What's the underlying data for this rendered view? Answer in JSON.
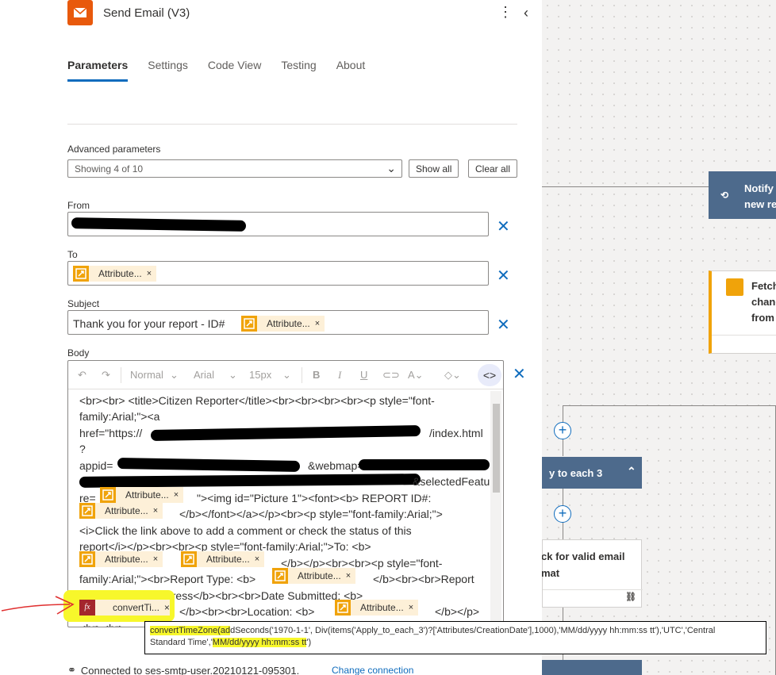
{
  "header": {
    "title": "Send Email (V3)",
    "icon": "mail-icon",
    "accent": "#e8590c"
  },
  "tabs": [
    {
      "label": "Parameters",
      "active": true
    },
    {
      "label": "Settings",
      "active": false
    },
    {
      "label": "Code View",
      "active": false
    },
    {
      "label": "Testing",
      "active": false
    },
    {
      "label": "About",
      "active": false
    }
  ],
  "advanced": {
    "label": "Advanced parameters",
    "value": "Showing 4 of 10",
    "show_all": "Show all",
    "clear_all": "Clear all"
  },
  "fields": {
    "from_label": "From",
    "to_label": "To",
    "to_token": "Attribute...",
    "subject_label": "Subject",
    "subject_text": "Thank you for your report - ID#",
    "subject_token": "Attribute...",
    "body_label": "Body"
  },
  "toolbar": {
    "style": "Normal",
    "font": "Arial",
    "size": "15px"
  },
  "body_lines": {
    "l1": "<br><br>  <title>Citizen Reporter</title><br><br><br><br><p style=\"font-",
    "l2": "family:Arial;\"><a",
    "l3": "href=\"https://",
    "l3b": "/index.html",
    "l4": "?",
    "l5": "appid=",
    "l5b": "&webmap=",
    "l6b": "&selectedFeatu",
    "l7a": "re=",
    "l7b": "\"><img id=\"Picture 1\"><font><b> REPORT ID#:",
    "l8": "</b></font></a></p><br><p style=\"font-family:Arial;\">",
    "l9": "<i>Click the link above to add a comment or check the status of this",
    "l10": "report</i></p><br><br><p style=\"font-family:Arial;\">To: <b>",
    "l11": "</b></p><br><br><p style=\"font-",
    "l12": "family:Arial;\"><br>Report Type: <b>",
    "l12b": "</b><br><br>Report",
    "l13": "Status: <b>In Progress</b><br><br>Date Submitted: <b>",
    "l14": "</b><br><br>Location: <b>",
    "l14b": "</b></p>",
    "l15": "<br><br>"
  },
  "tokens": {
    "attr": "Attribute...",
    "fx": "convertTi..."
  },
  "tooltip": {
    "highlight": "convertTimeZone(ad",
    "text1": "dSeconds('1970-1-1', Div(items('Apply_to_each_3')?['Attributes/CreationDate'],1000),'MM/dd/yyyy hh:mm:ss tt'),'UTC','Central",
    "text2a": "Standard Time','",
    "text2hl": "MM/dd/yyyy hh:mm:ss tt",
    "text2b": "')"
  },
  "footer": {
    "connected": "Connected to ses-smtp-user.20210121-095301.",
    "change": "Change connection"
  },
  "canvas": {
    "notify": "Notify",
    "notify2": "new re",
    "fetch": "Fetch",
    "fetch2": "chang",
    "fetch3": "from",
    "apply": "y to each 3",
    "check1": "ck for valid email",
    "check2": "mat"
  }
}
